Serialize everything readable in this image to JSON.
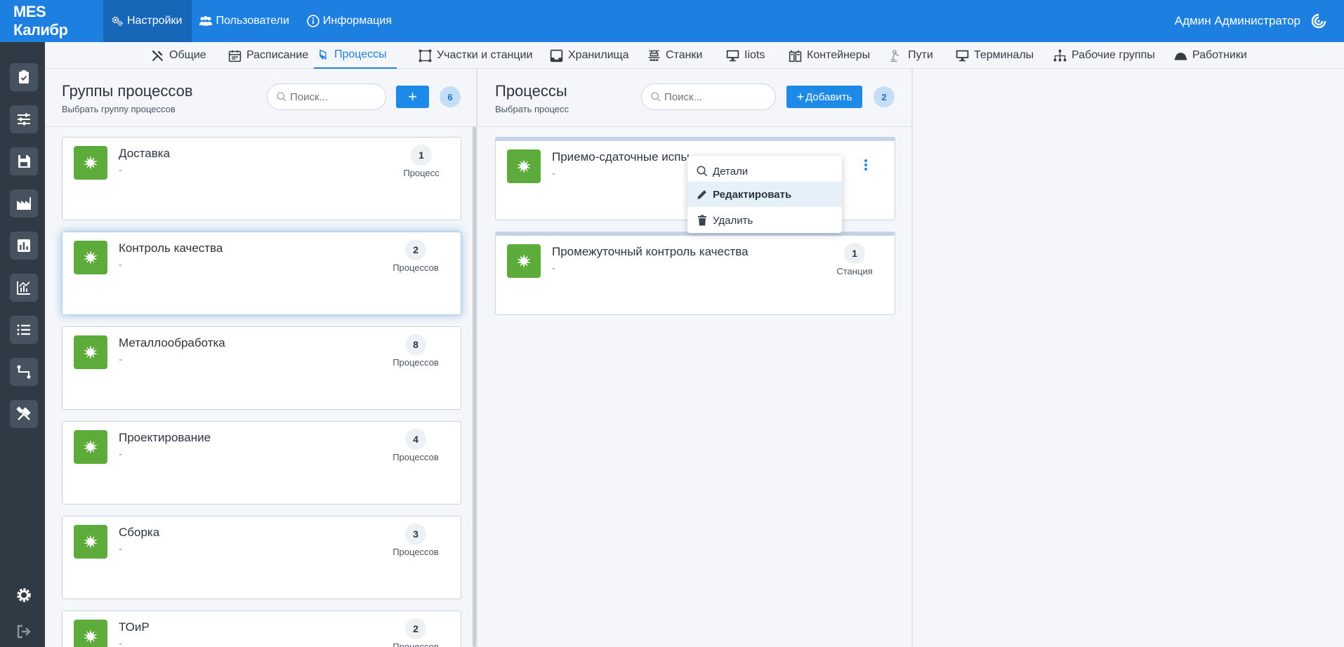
{
  "app": {
    "brand": "MES Калибр"
  },
  "topnav": {
    "settings": "Настройки",
    "users": "Пользователи",
    "info": "Информация"
  },
  "user": {
    "name": "Админ Администратор"
  },
  "subnav": {
    "general": "Общие",
    "schedule": "Расписание",
    "processes": "Процессы",
    "areas": "Участки и станции",
    "storage": "Хранилища",
    "machines": "Станки",
    "iiots": "Iiots",
    "containers": "Контейнеры",
    "paths": "Пути",
    "terminals": "Терминалы",
    "workgroups": "Рабочие группы",
    "workers": "Работники"
  },
  "groups_panel": {
    "title": "Группы процессов",
    "subtitle": "Выбрать группу процессов",
    "search_placeholder": "Поиск...",
    "add_label": "+",
    "count": "6",
    "items": [
      {
        "name": "Доставка",
        "desc": "-",
        "count": "1",
        "unit": "Процесс"
      },
      {
        "name": "Контроль качества",
        "desc": "-",
        "count": "2",
        "unit": "Процессов"
      },
      {
        "name": "Металлообработка",
        "desc": "-",
        "count": "8",
        "unit": "Процессов"
      },
      {
        "name": "Проектирование",
        "desc": "-",
        "count": "4",
        "unit": "Процессов"
      },
      {
        "name": "Сборка",
        "desc": "-",
        "count": "3",
        "unit": "Процессов"
      },
      {
        "name": "ТОиР",
        "desc": "-",
        "count": "2",
        "unit": "Процессов"
      }
    ]
  },
  "processes_panel": {
    "title": "Процессы",
    "subtitle": "Выбрать процесс",
    "search_placeholder": "Поиск...",
    "add_label": "Добавить",
    "count": "2",
    "items": [
      {
        "name": "Приемо-сдаточные испы",
        "desc": "-"
      },
      {
        "name": "Промежуточный контроль качества",
        "desc": "-",
        "count": "1",
        "unit": "Станция"
      }
    ]
  },
  "context_menu": {
    "details": "Детали",
    "edit": "Редактировать",
    "delete": "Удалить"
  },
  "colors": {
    "primary": "#1d7fe0",
    "sidebar": "#2f3a45",
    "process_icon": "#5dab3a"
  }
}
